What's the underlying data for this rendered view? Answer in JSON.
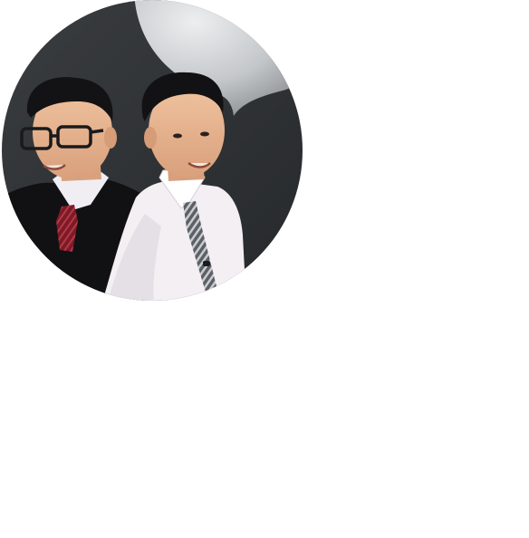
{
  "avatar": {
    "description_icon": "portrait-photo",
    "shape": "circle",
    "colors": {
      "background": "#2f3234",
      "bubble_light": "#e6e8ea",
      "bubble_dark": "#8f9397",
      "page": "#ffffff",
      "skin": "#e7b591",
      "hair": "#141416",
      "shirt": "#f2eef2",
      "vest": "#111112",
      "tie_left": "#8a1f2c",
      "tie_right": "#6f7278"
    }
  }
}
